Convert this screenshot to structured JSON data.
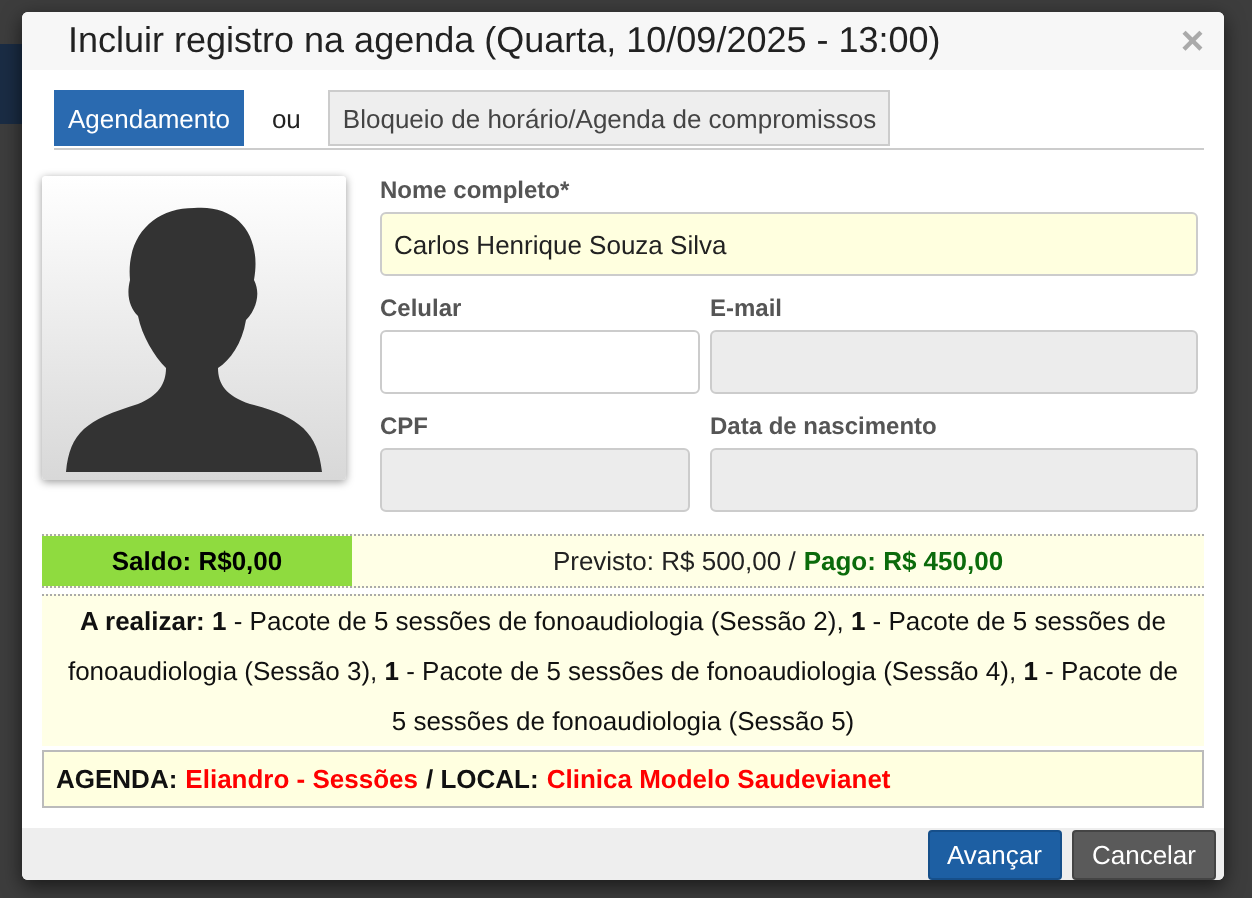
{
  "dialog": {
    "title": "Incluir registro na agenda (Quarta, 10/09/2025 - 13:00)",
    "close": "×"
  },
  "tabs": [
    {
      "label": "Agendamento",
      "selected": true
    },
    {
      "label": "Bloqueio de horário/Agenda de compromissos",
      "selected": false
    }
  ],
  "tab_separator": "ou",
  "fields": [
    {
      "label": "Nome completo*",
      "value": "Carlos Henrique Souza Silva",
      "disabled": false,
      "highlighted": true
    },
    {
      "label": "Celular",
      "disabled": false,
      "highlighted": false
    },
    {
      "label": "E-mail",
      "disabled": true,
      "highlighted": false
    },
    {
      "label": "CPF",
      "disabled": true,
      "highlighted": false
    },
    {
      "label": "Data de nascimento",
      "disabled": true,
      "highlighted": false
    }
  ],
  "balance": {
    "saldo": "Saldo: R$0,00",
    "previsto": "Previsto: R$ 500,00 /",
    "pago": "Pago: R$ 450,00"
  },
  "pending": "**A realizar: 1** - Pacote de 5 sessões de fonoaudiologia (Sessão 2), **1** - Pacote de 5 sessões de fonoaudiologia (Sessão 3), **1** - Pacote de 5 sessões de fonoaudiologia (Sessão 4), **1** - Pacote de 5 sessões de fonoaudiologia (Sessão 5)",
  "agenda": [
    {
      "kind": "label",
      "text": "AGENDA:"
    },
    {
      "kind": "value",
      "text": "Eliandro - Sessões"
    },
    {
      "kind": "label",
      "text": "/ LOCAL:"
    },
    {
      "kind": "value",
      "text": "Clinica Modelo Saudevianet"
    }
  ],
  "buttons": [
    {
      "label": "Avançar",
      "kind": "primary"
    },
    {
      "label": "Cancelar",
      "kind": "secondary"
    }
  ]
}
